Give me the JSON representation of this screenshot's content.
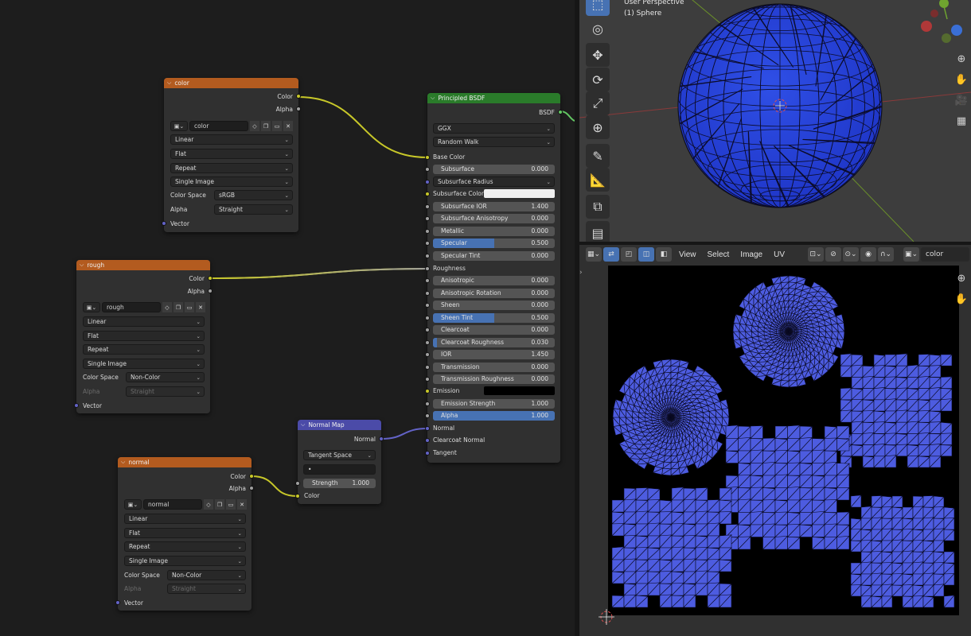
{
  "colors": {
    "texture_header": "#b35b1f",
    "shader_header": "#2a7b2a",
    "vector_header": "#4b4ba8",
    "socket_color": "#c7c729",
    "socket_float": "#a1a1a1",
    "socket_vector": "#6363c7",
    "socket_shader": "#63c763",
    "accent": "#4772b3",
    "uv_face": "#4d5ce0"
  },
  "nodes": {
    "color_tex": {
      "title": "color",
      "out_color": "Color",
      "out_alpha": "Alpha",
      "image": "color",
      "interpolation": "Linear",
      "projection": "Flat",
      "extension": "Repeat",
      "source": "Single Image",
      "color_space_label": "Color Space",
      "color_space": "sRGB",
      "alpha_label": "Alpha",
      "alpha_mode": "Straight",
      "in_vector": "Vector"
    },
    "rough_tex": {
      "title": "rough",
      "out_color": "Color",
      "out_alpha": "Alpha",
      "image": "rough",
      "interpolation": "Linear",
      "projection": "Flat",
      "extension": "Repeat",
      "source": "Single Image",
      "color_space_label": "Color Space",
      "color_space": "Non-Color",
      "alpha_label": "Alpha",
      "alpha_mode": "Straight",
      "in_vector": "Vector"
    },
    "normal_tex": {
      "title": "normal",
      "out_color": "Color",
      "out_alpha": "Alpha",
      "image": "normal",
      "interpolation": "Linear",
      "projection": "Flat",
      "extension": "Repeat",
      "source": "Single Image",
      "color_space_label": "Color Space",
      "color_space": "Non-Color",
      "alpha_label": "Alpha",
      "alpha_mode": "Straight",
      "in_vector": "Vector"
    },
    "normal_map": {
      "title": "Normal Map",
      "out_normal": "Normal",
      "space": "Tangent Space",
      "uv_map": "•",
      "strength_label": "Strength",
      "strength": "1.000",
      "strength_fraction": 1.0,
      "in_color": "Color"
    },
    "bsdf": {
      "title": "Principled BSDF",
      "out": "BSDF",
      "distribution": "GGX",
      "subsurface_method": "Random Walk",
      "base_color": "Base Color",
      "subsurface_radius": "Subsurface Radius",
      "subsurface_color": "Subsurface Color",
      "roughness": "Roughness",
      "emission": "Emission",
      "normal": "Normal",
      "clearcoat_normal": "Clearcoat Normal",
      "tangent": "Tangent",
      "sliders": [
        {
          "label": "Subsurface",
          "value": "0.000",
          "fill": 0.0,
          "socket": "g"
        },
        {
          "label": "Subsurface IOR",
          "value": "1.400",
          "fill": 0.0,
          "socket": "g"
        },
        {
          "label": "Subsurface Anisotropy",
          "value": "0.000",
          "fill": 0.0,
          "socket": "g"
        },
        {
          "label": "Metallic",
          "value": "0.000",
          "fill": 0.0,
          "socket": "g"
        },
        {
          "label": "Specular",
          "value": "0.500",
          "fill": 0.5,
          "socket": "g"
        },
        {
          "label": "Specular Tint",
          "value": "0.000",
          "fill": 0.0,
          "socket": "g"
        },
        {
          "label": "Anisotropic",
          "value": "0.000",
          "fill": 0.0,
          "socket": "g"
        },
        {
          "label": "Anisotropic Rotation",
          "value": "0.000",
          "fill": 0.0,
          "socket": "g"
        },
        {
          "label": "Sheen",
          "value": "0.000",
          "fill": 0.0,
          "socket": "g"
        },
        {
          "label": "Sheen Tint",
          "value": "0.500",
          "fill": 0.5,
          "socket": "g"
        },
        {
          "label": "Clearcoat",
          "value": "0.000",
          "fill": 0.0,
          "socket": "g"
        },
        {
          "label": "Clearcoat Roughness",
          "value": "0.030",
          "fill": 0.03,
          "socket": "g"
        },
        {
          "label": "IOR",
          "value": "1.450",
          "fill": 0.0,
          "socket": "g"
        },
        {
          "label": "Transmission",
          "value": "0.000",
          "fill": 0.0,
          "socket": "g"
        },
        {
          "label": "Transmission Roughness",
          "value": "0.000",
          "fill": 0.0,
          "socket": "g"
        },
        {
          "label": "Emission Strength",
          "value": "1.000",
          "fill": 0.0,
          "socket": "g"
        },
        {
          "label": "Alpha",
          "value": "1.000",
          "fill": 1.0,
          "socket": "g"
        }
      ]
    }
  },
  "viewport": {
    "line1": "User Perspective",
    "line2": "(1) Sphere"
  },
  "uv_editor": {
    "menu": [
      "View",
      "Select",
      "Image",
      "UV"
    ],
    "image_name": "color"
  }
}
